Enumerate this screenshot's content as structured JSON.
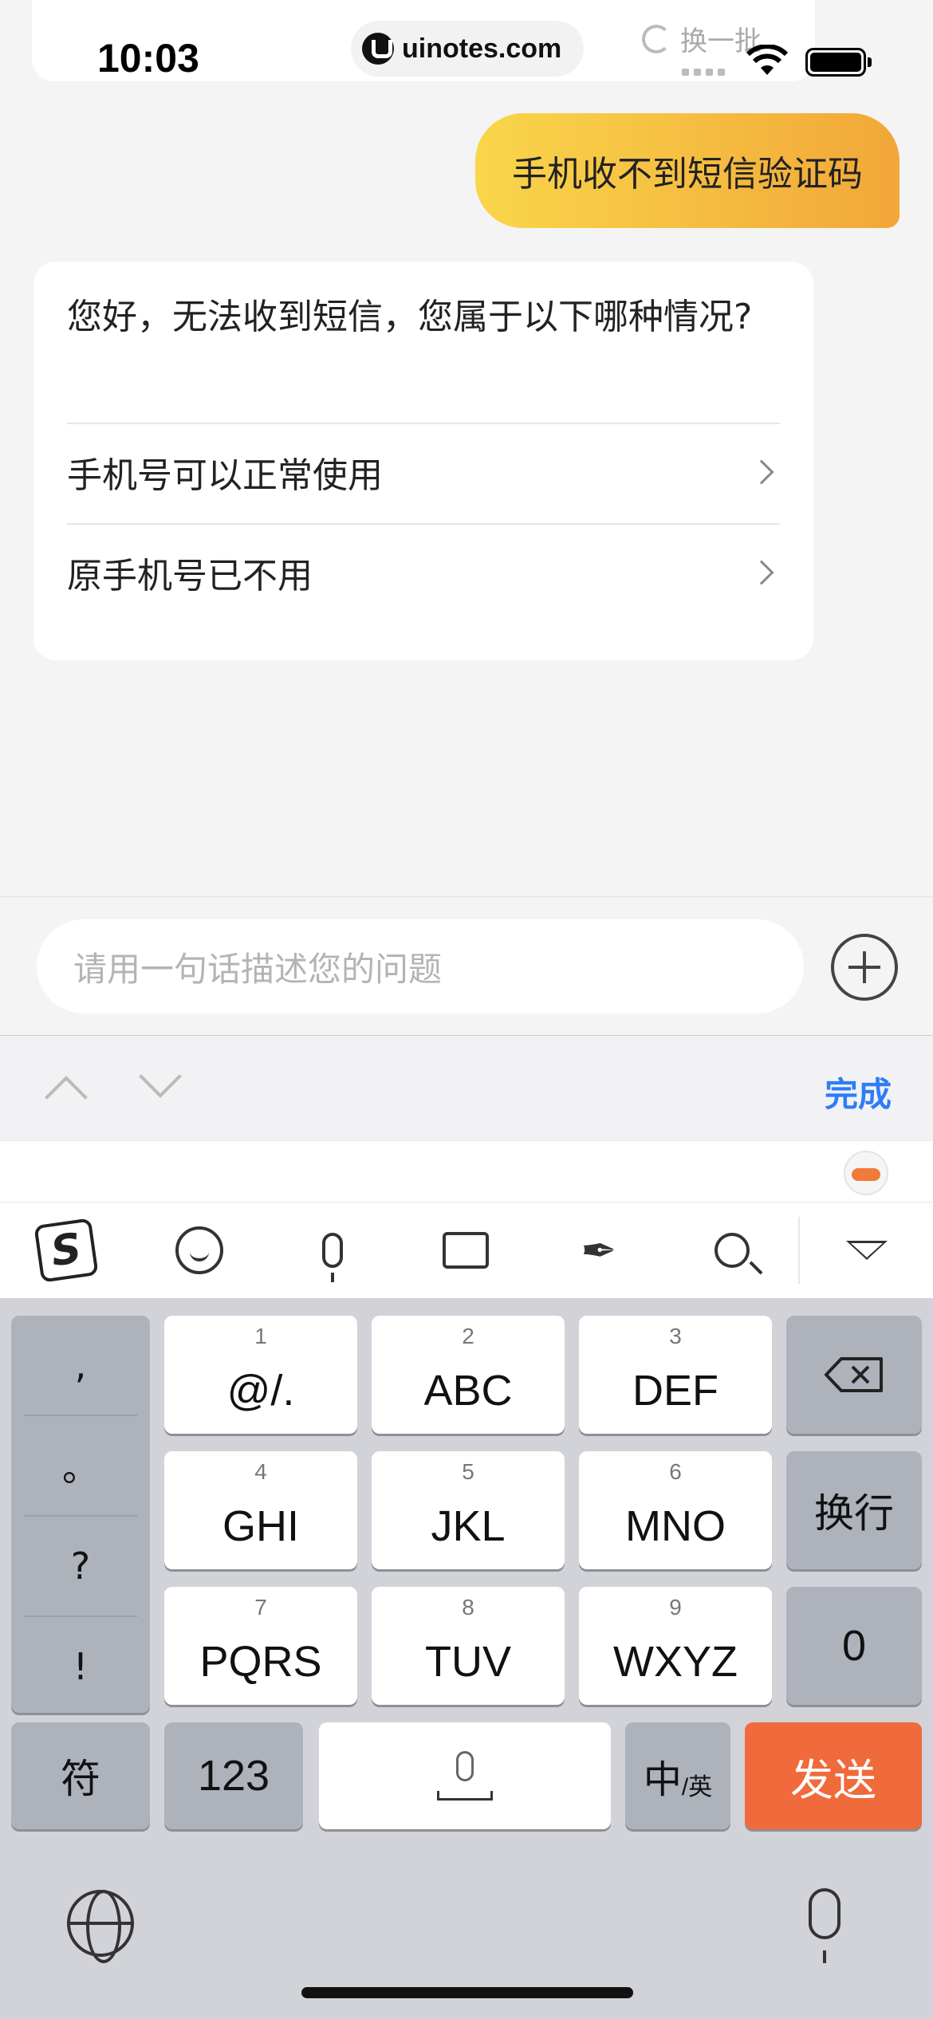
{
  "status_bar": {
    "time": "10:03",
    "url": "uinotes.com",
    "refresh_label": "换一批"
  },
  "chat": {
    "user_message": "手机收不到短信验证码",
    "bot_message": "您好，无法收到短信，您属于以下哪种情况?",
    "options": [
      {
        "label": "手机号可以正常使用"
      },
      {
        "label": "原手机号已不用"
      }
    ]
  },
  "input": {
    "placeholder": "请用一句话描述您的问题"
  },
  "accessory": {
    "done_label": "完成"
  },
  "keyboard": {
    "punctuation": [
      ",",
      "。",
      "?",
      "!"
    ],
    "keys": [
      {
        "num": "1",
        "label": "@/."
      },
      {
        "num": "2",
        "label": "ABC"
      },
      {
        "num": "3",
        "label": "DEF"
      },
      {
        "num": "4",
        "label": "GHI"
      },
      {
        "num": "5",
        "label": "JKL"
      },
      {
        "num": "6",
        "label": "MNO"
      },
      {
        "num": "7",
        "label": "PQRS"
      },
      {
        "num": "8",
        "label": "TUV"
      },
      {
        "num": "9",
        "label": "WXYZ"
      }
    ],
    "newline_label": "换行",
    "zero_label": "0",
    "symbol_label": "符",
    "numeric_label": "123",
    "lang_main": "中",
    "lang_sub": "/英",
    "send_label": "发送",
    "send_color": "#f06a3c"
  }
}
